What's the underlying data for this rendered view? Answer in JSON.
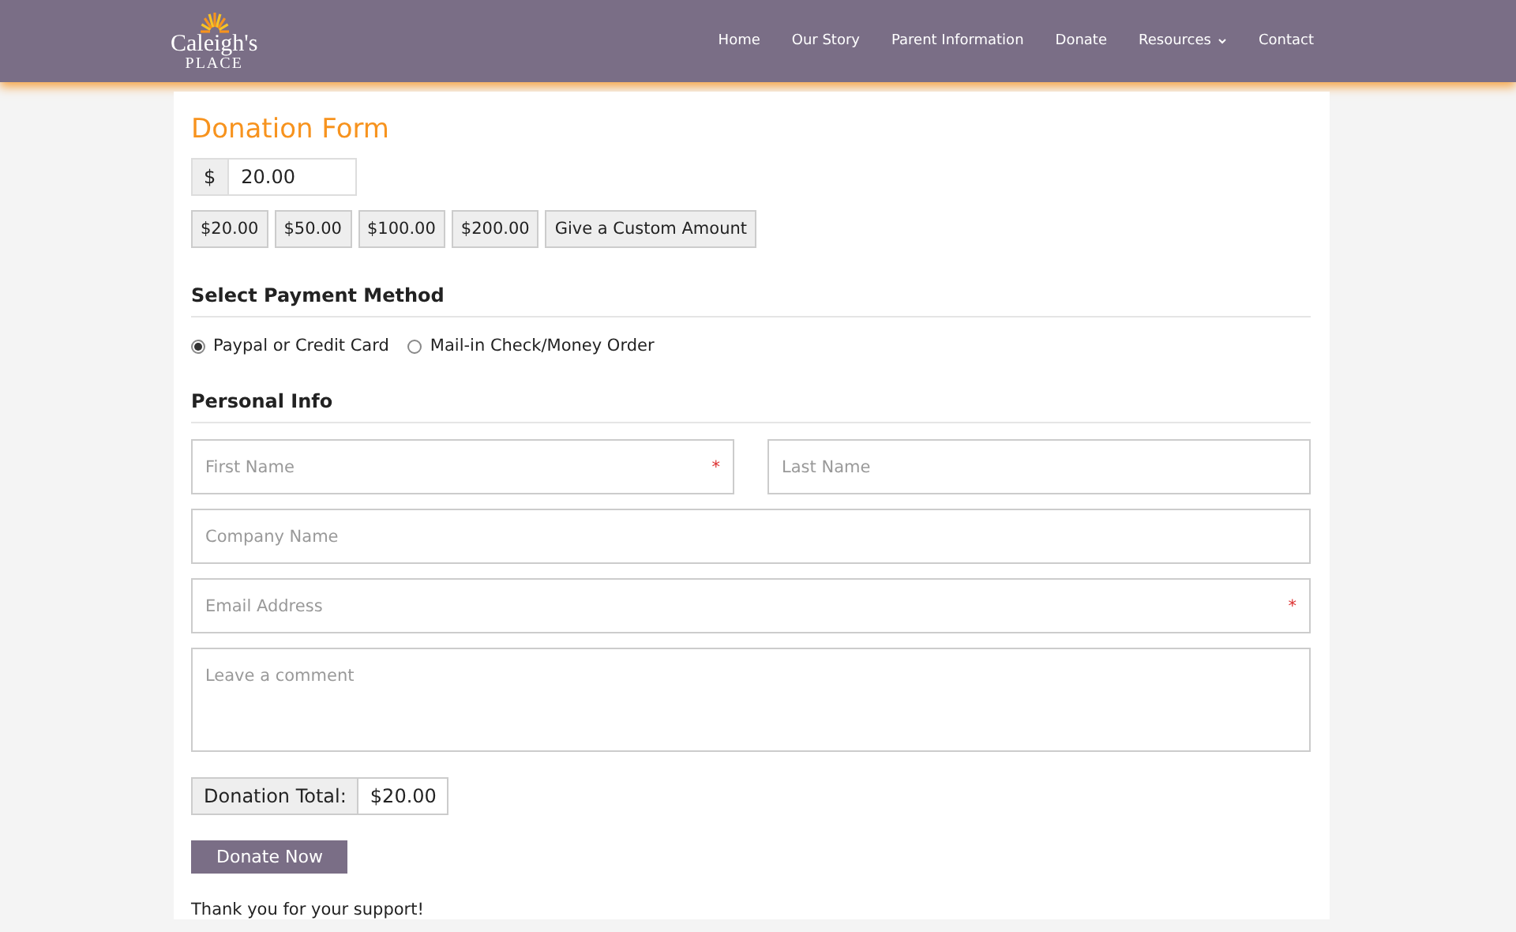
{
  "logo": {
    "name": "Caleigh's",
    "sub": "PLACE"
  },
  "nav": [
    {
      "label": "Home",
      "dropdown": false
    },
    {
      "label": "Our Story",
      "dropdown": false
    },
    {
      "label": "Parent Information",
      "dropdown": false
    },
    {
      "label": "Donate",
      "dropdown": false
    },
    {
      "label": "Resources",
      "dropdown": true
    },
    {
      "label": "Contact",
      "dropdown": false
    }
  ],
  "title": "Donation Form",
  "amount": {
    "currency": "$",
    "value": "20.00"
  },
  "presets": [
    "$20.00",
    "$50.00",
    "$100.00",
    "$200.00",
    "Give a Custom Amount"
  ],
  "payment": {
    "heading": "Select Payment Method",
    "options": [
      {
        "label": "Paypal or Credit Card",
        "selected": true
      },
      {
        "label": "Mail-in Check/Money Order",
        "selected": false
      }
    ]
  },
  "personal": {
    "heading": "Personal Info",
    "rows": [
      [
        {
          "placeholder": "First Name",
          "required_mark": "*"
        },
        {
          "placeholder": "Last Name"
        }
      ],
      [
        {
          "placeholder": "Company Name"
        }
      ],
      [
        {
          "placeholder": "Email Address",
          "required_mark": "*"
        }
      ]
    ],
    "comment": {
      "placeholder": "Leave a comment"
    }
  },
  "total": {
    "label": "Donation Total:",
    "value": "$20.00"
  },
  "submit": "Donate Now",
  "thanks": "Thank you for your support!"
}
